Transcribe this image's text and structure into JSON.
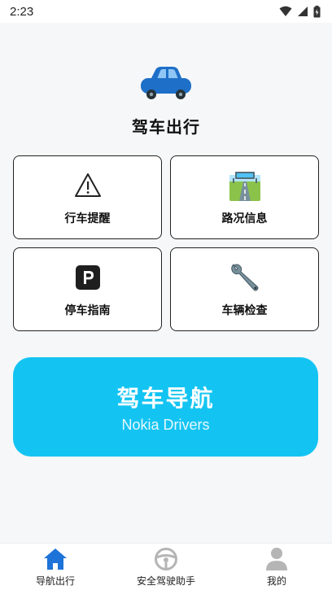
{
  "status": {
    "time": "2:23"
  },
  "hero": {
    "title": "驾车出行"
  },
  "cards": [
    {
      "label": "行车提醒",
      "icon": "warning-icon"
    },
    {
      "label": "路况信息",
      "icon": "road-icon"
    },
    {
      "label": "停车指南",
      "icon": "parking-icon"
    },
    {
      "label": "车辆检查",
      "icon": "wrench-icon"
    }
  ],
  "nav_banner": {
    "title": "驾车导航",
    "subtitle": "Nokia Drivers"
  },
  "tabs": [
    {
      "label": "导航出行",
      "icon": "home-icon",
      "active": true
    },
    {
      "label": "安全驾驶助手",
      "icon": "steering-wheel-icon",
      "active": false
    },
    {
      "label": "我的",
      "icon": "user-icon",
      "active": false
    }
  ],
  "colors": {
    "accent": "#13c4f2",
    "car_blue": "#1e6fc8",
    "tab_active": "#1e73d8",
    "tab_inactive": "#b5b5b5"
  }
}
